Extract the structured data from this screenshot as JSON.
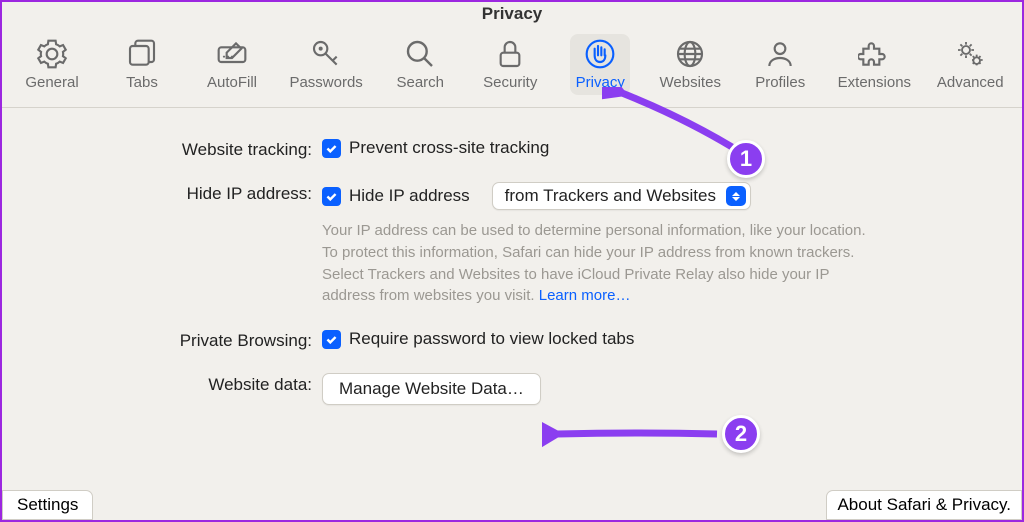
{
  "window_title": "Privacy",
  "toolbar": {
    "items": [
      {
        "label": "General"
      },
      {
        "label": "Tabs"
      },
      {
        "label": "AutoFill"
      },
      {
        "label": "Passwords"
      },
      {
        "label": "Search"
      },
      {
        "label": "Security"
      },
      {
        "label": "Privacy"
      },
      {
        "label": "Websites"
      },
      {
        "label": "Profiles"
      },
      {
        "label": "Extensions"
      },
      {
        "label": "Advanced"
      }
    ],
    "active_index": 6
  },
  "sections": {
    "tracking": {
      "label": "Website tracking:",
      "checkbox_label": "Prevent cross-site tracking",
      "checked": true
    },
    "hide_ip": {
      "label": "Hide IP address:",
      "checkbox_label": "Hide IP address",
      "checked": true,
      "dropdown_value": "from Trackers and Websites",
      "description": "Your IP address can be used to determine personal information, like your location. To protect this information, Safari can hide your IP address from known trackers. Select Trackers and Websites to have iCloud Private Relay also hide your IP address from websites you visit.",
      "learn_more": "Learn more…"
    },
    "private_browsing": {
      "label": "Private Browsing:",
      "checkbox_label": "Require password to view locked tabs",
      "checked": true
    },
    "website_data": {
      "label": "Website data:",
      "button_label": "Manage Website Data…"
    }
  },
  "footer": {
    "left": "Settings",
    "right": "About Safari & Privacy."
  },
  "annotations": {
    "badge1": "1",
    "badge2": "2"
  }
}
